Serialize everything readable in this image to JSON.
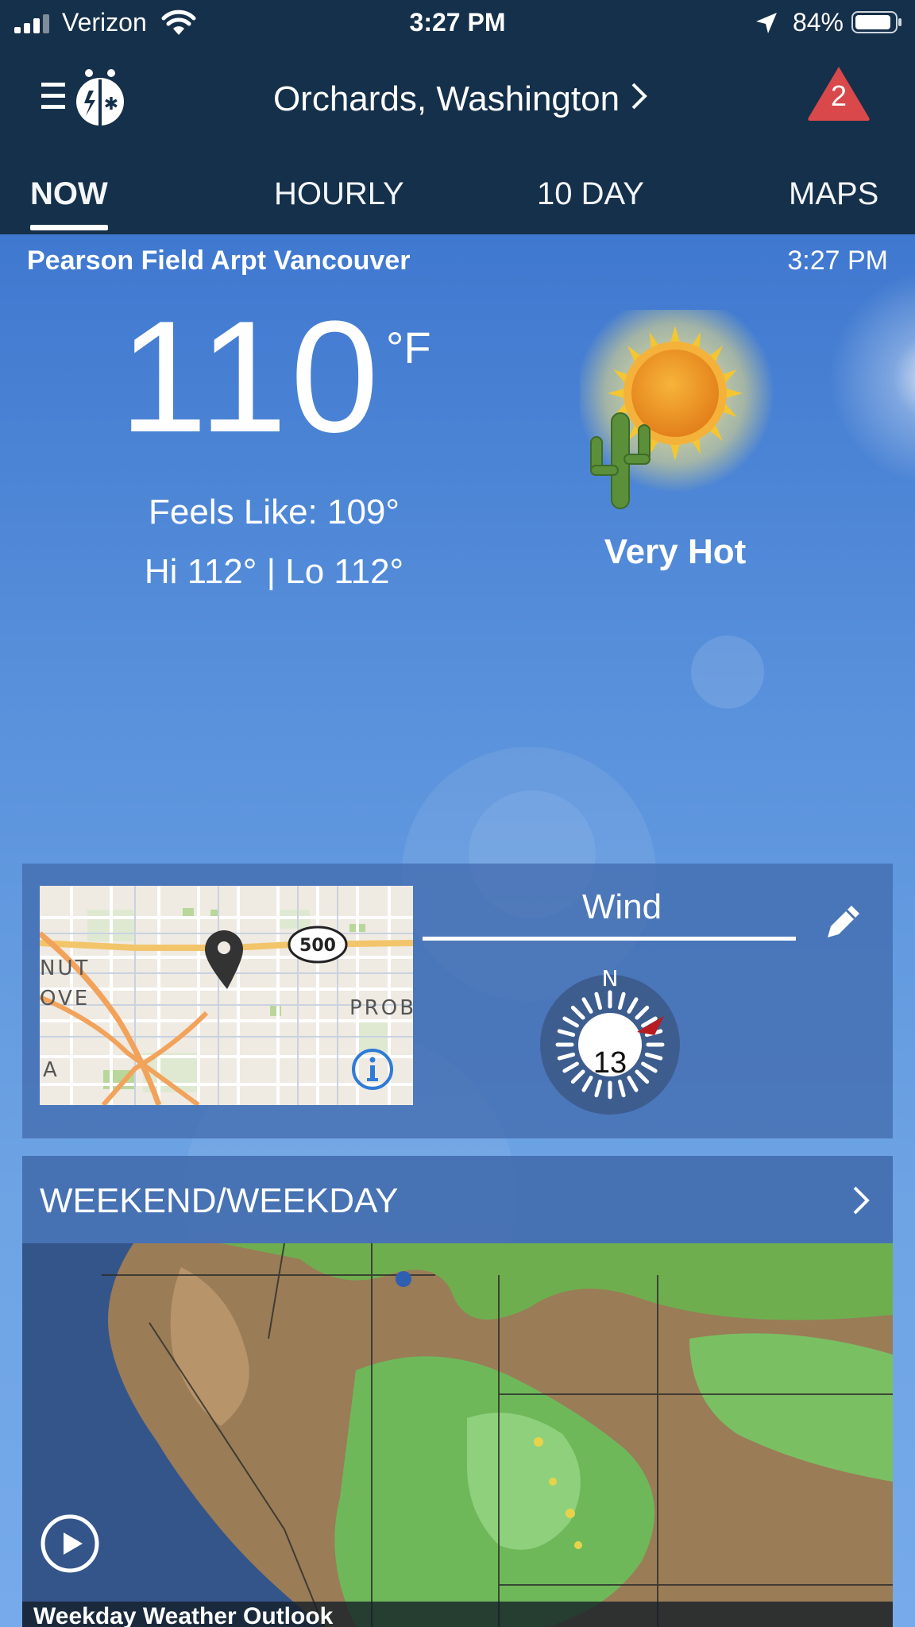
{
  "status_bar": {
    "carrier": "Verizon",
    "time": "3:27 PM",
    "battery_percent": "84%"
  },
  "header": {
    "location": "Orchards, Washington",
    "alert_count": "2"
  },
  "tabs": [
    {
      "label": "NOW",
      "active": true
    },
    {
      "label": "HOURLY",
      "active": false
    },
    {
      "label": "10 DAY",
      "active": false
    },
    {
      "label": "MAPS",
      "active": false
    }
  ],
  "current": {
    "station": "Pearson Field Arpt Vancouver",
    "observed_time": "3:27 PM",
    "temperature": "110",
    "unit": "°F",
    "feels_like": "Feels Like: 109°",
    "hi_lo": "Hi 112° | Lo 112°",
    "condition": "Very Hot",
    "condition_icon": "sun-cactus-icon"
  },
  "map_card": {
    "highway_label": "500",
    "place_labels": [
      "NUT",
      "OVE",
      "PROB",
      "A"
    ],
    "wind_title": "Wind",
    "wind_speed": "13",
    "wind_direction_label": "N"
  },
  "outlook_card": {
    "title": "WEEKEND/WEEKDAY",
    "video_caption": "Weekday Weather Outlook"
  },
  "colors": {
    "header_bg": "#15304a",
    "sky_top": "#3f78cf",
    "alert_red": "#d9484a",
    "wind_arrow": "#e0262b"
  }
}
